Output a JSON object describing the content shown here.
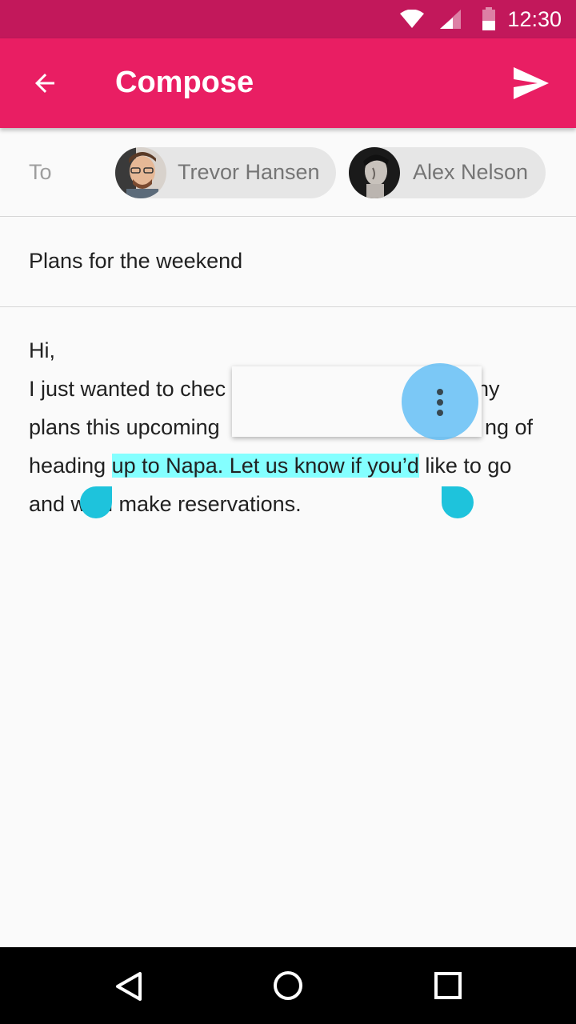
{
  "status_bar": {
    "time": "12:30",
    "icons": [
      "wifi-icon",
      "cell-signal-icon",
      "battery-icon"
    ]
  },
  "app_bar": {
    "title": "Compose",
    "back_icon": "arrow-back-icon",
    "send_icon": "send-icon"
  },
  "recipients": {
    "label": "To",
    "chips": [
      {
        "name": "Trevor Hansen",
        "avatar": "avatar-trevor-hansen"
      },
      {
        "name": "Alex Nelson",
        "avatar": "avatar-alex-nelson"
      }
    ]
  },
  "subject": "Plans for the weekend",
  "body": {
    "line1": "Hi,",
    "line2_start": "I just wanted to chec",
    "line2_end": "ny",
    "line3_start": "plans this upcoming",
    "line3_end": "ng of",
    "line4_before": "heading ",
    "line4_selected": "up to Napa. Let us know if you’d",
    "line4_after": " like to go",
    "line5": "and we’ll make reservations."
  },
  "selection_toolbar": {
    "overflow_icon": "more-vert-icon"
  },
  "nav_bar": {
    "icons": [
      "back-triangle-icon",
      "home-circle-icon",
      "recents-square-icon"
    ]
  },
  "colors": {
    "status_bar": "#c2185b",
    "app_bar": "#e91e63",
    "selection": "#84ffff",
    "handle": "#1ec3dc"
  }
}
